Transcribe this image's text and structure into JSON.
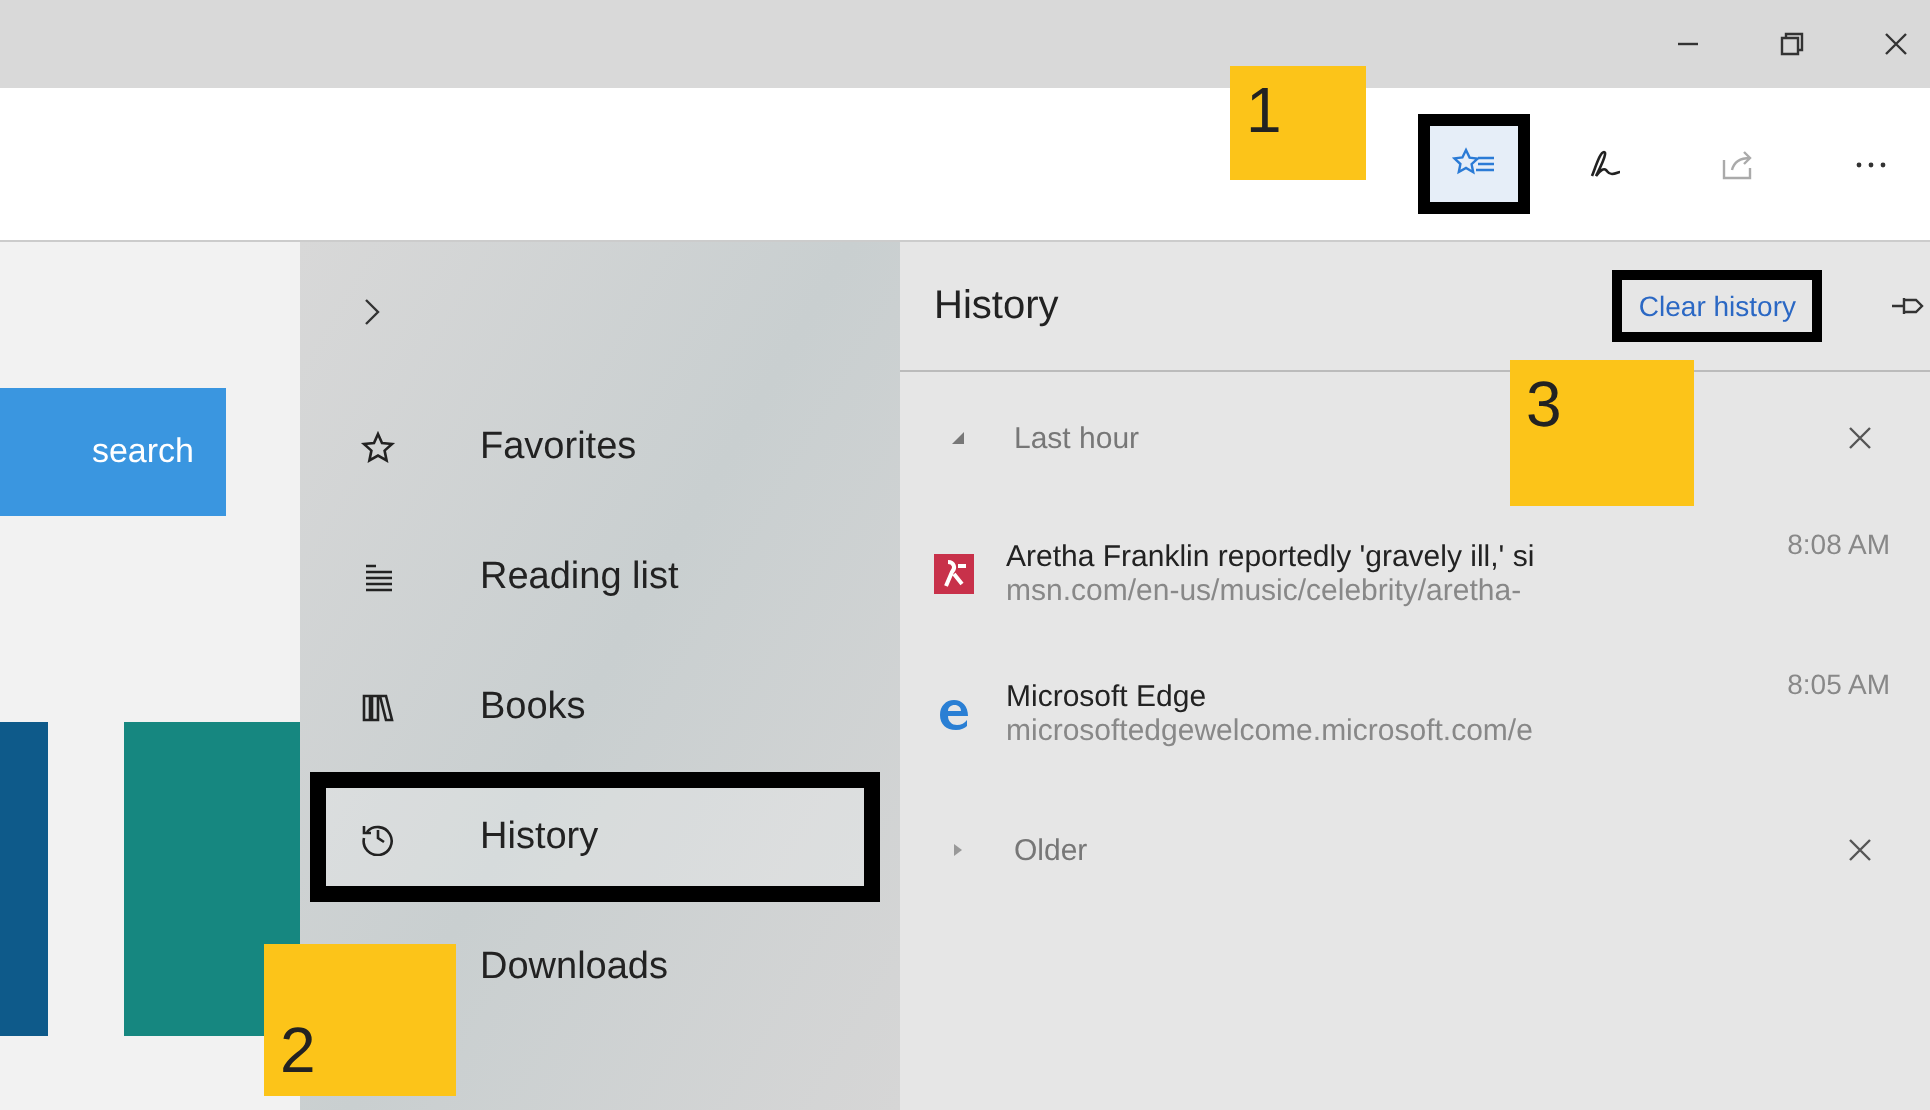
{
  "toolbar": {
    "buttons": [
      {
        "kind": "hub",
        "highlighted": true
      },
      {
        "kind": "pen",
        "highlighted": false
      },
      {
        "kind": "share",
        "highlighted": false
      },
      {
        "kind": "more",
        "highlighted": false
      }
    ]
  },
  "page": {
    "search_button": "search"
  },
  "hub_menu": {
    "items": [
      {
        "kind": "favorites",
        "label": "Favorites",
        "highlighted": false
      },
      {
        "kind": "reading",
        "label": "Reading list",
        "highlighted": false
      },
      {
        "kind": "books",
        "label": "Books",
        "highlighted": false
      },
      {
        "kind": "history",
        "label": "History",
        "highlighted": true
      },
      {
        "kind": "downloads",
        "label": "Downloads",
        "highlighted": false
      }
    ]
  },
  "history_panel": {
    "title": "History",
    "clear_link": "Clear history",
    "clear_highlighted": true,
    "groups": [
      {
        "label": "Last hour",
        "expanded": true,
        "entries": [
          {
            "kind": "msn",
            "title": "Aretha Franklin reportedly 'gravely ill,' si",
            "url": "msn.com/en-us/music/celebrity/aretha-",
            "time": "8:08 AM"
          },
          {
            "kind": "edge",
            "title": "Microsoft Edge",
            "url": "microsoftedgewelcome.microsoft.com/e",
            "time": "8:05 AM"
          }
        ]
      },
      {
        "label": "Older",
        "expanded": false
      }
    ]
  },
  "callouts": [
    {
      "label": "1"
    },
    {
      "label": "2"
    },
    {
      "label": "3"
    }
  ]
}
